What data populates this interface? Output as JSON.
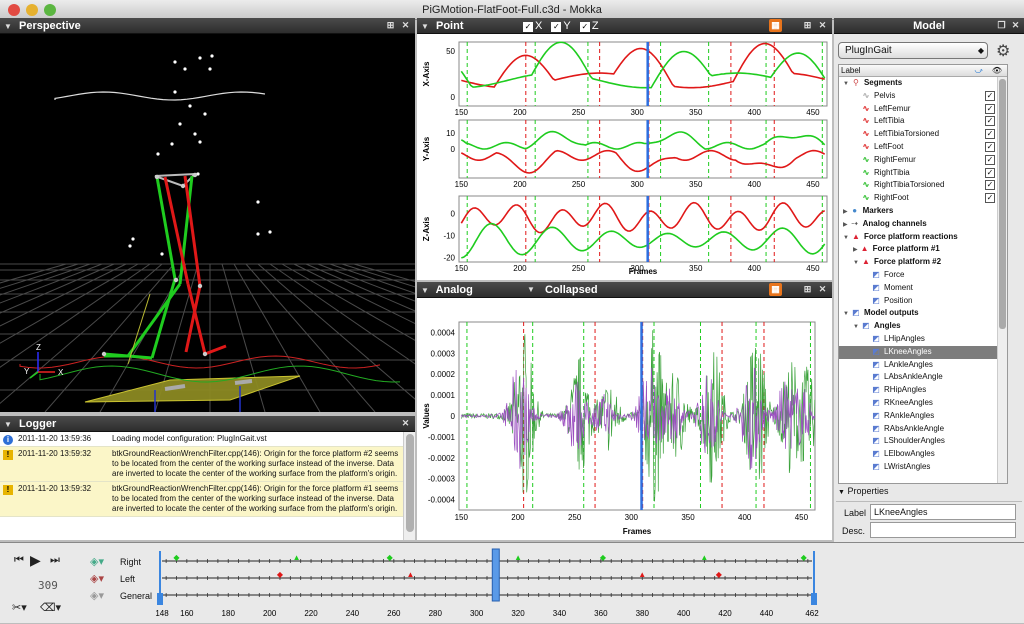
{
  "window": {
    "title": "PiGMotion-FlatFoot-Full.c3d - Mokka"
  },
  "perspective": {
    "title": "Perspective",
    "axes": {
      "x": "X",
      "y": "Y",
      "z": "Z"
    }
  },
  "point": {
    "title": "Point",
    "checks": [
      {
        "label": "X",
        "checked": true
      },
      {
        "label": "Y",
        "checked": true
      },
      {
        "label": "Z",
        "checked": true
      }
    ],
    "xlabel": "Frames",
    "xticks": [
      "150",
      "200",
      "250",
      "300",
      "350",
      "400",
      "450"
    ],
    "plots": [
      {
        "ylabel": "X-Axis",
        "yticks": [
          "50",
          "0"
        ]
      },
      {
        "ylabel": "Y-Axis",
        "yticks": [
          "10",
          "0"
        ]
      },
      {
        "ylabel": "Z-Axis",
        "yticks": [
          "0",
          "-10",
          "-20"
        ]
      }
    ]
  },
  "analog": {
    "title": "Analog",
    "mode": "Collapsed",
    "ylabel": "Values",
    "xlabel": "Frames",
    "yticks": [
      "0.0004",
      "0.0003",
      "0.0002",
      "0.0001",
      "0",
      "-0.0001",
      "-0.0002",
      "-0.0003",
      "-0.0004"
    ],
    "xticks": [
      "150",
      "200",
      "250",
      "300",
      "350",
      "400",
      "450"
    ]
  },
  "logger": {
    "title": "Logger",
    "entries": [
      {
        "level": "info",
        "time": "2011-11-20 13:59:36",
        "text": "Loading model configuration: PlugInGait.vst"
      },
      {
        "level": "warn",
        "time": "2011-11-20 13:59:32",
        "text": "btkGroundReactionWrenchFilter.cpp(146): Origin for the force platform #2 seems to be located from the center of the working surface instead of the inverse. Data are inverted to locate the center of the working surface from the platform's origin."
      },
      {
        "level": "warn",
        "time": "2011-11-20 13:59:32",
        "text": "btkGroundReactionWrenchFilter.cpp(146): Origin for the force platform #1 seems to be located from the center of the working surface instead of the inverse. Data are inverted to locate the center of the working surface from the platform's origin."
      }
    ]
  },
  "model": {
    "title": "Model",
    "selector": "PlugInGait",
    "column": "Label",
    "tree": [
      {
        "label": "Segments",
        "level": 0,
        "bold": true,
        "icon": "segments-icon"
      },
      {
        "label": "Pelvis",
        "level": 1,
        "check": true,
        "color": "#aaaaaa"
      },
      {
        "label": "LeftFemur",
        "level": 1,
        "check": true,
        "color": "#dd2020"
      },
      {
        "label": "LeftTibia",
        "level": 1,
        "check": true,
        "color": "#dd2020"
      },
      {
        "label": "LeftTibiaTorsioned",
        "level": 1,
        "check": true,
        "color": "#dd2020"
      },
      {
        "label": "LeftFoot",
        "level": 1,
        "check": true,
        "color": "#dd2020"
      },
      {
        "label": "RightFemur",
        "level": 1,
        "check": true,
        "color": "#22bb22"
      },
      {
        "label": "RightTibia",
        "level": 1,
        "check": true,
        "color": "#22bb22"
      },
      {
        "label": "RightTibiaTorsioned",
        "level": 1,
        "check": true,
        "color": "#22bb22"
      },
      {
        "label": "RightFoot",
        "level": 1,
        "check": true,
        "color": "#22bb22"
      },
      {
        "label": "Markers",
        "level": 0,
        "bold": true,
        "icon": "markers-icon"
      },
      {
        "label": "Analog channels",
        "level": 0,
        "bold": true,
        "icon": "analog-icon"
      },
      {
        "label": "Force platform reactions",
        "level": 0,
        "bold": true,
        "icon": "force-icon"
      },
      {
        "label": "Force platform #1",
        "level": 1,
        "bold": true,
        "icon": "force-icon"
      },
      {
        "label": "Force platform #2",
        "level": 1,
        "bold": true,
        "icon": "force-icon"
      },
      {
        "label": "Force",
        "level": 2,
        "icon": "graph-icon"
      },
      {
        "label": "Moment",
        "level": 2,
        "icon": "graph-icon"
      },
      {
        "label": "Position",
        "level": 2,
        "icon": "graph-icon"
      },
      {
        "label": "Model outputs",
        "level": 0,
        "bold": true,
        "icon": "graph-icon"
      },
      {
        "label": "Angles",
        "level": 1,
        "bold": true,
        "icon": "graph-icon"
      },
      {
        "label": "LHipAngles",
        "level": 2,
        "icon": "graph-icon"
      },
      {
        "label": "LKneeAngles",
        "level": 2,
        "icon": "graph-icon",
        "selected": true
      },
      {
        "label": "LAnkleAngles",
        "level": 2,
        "icon": "graph-icon"
      },
      {
        "label": "LAbsAnkleAngle",
        "level": 2,
        "icon": "graph-icon"
      },
      {
        "label": "RHipAngles",
        "level": 2,
        "icon": "graph-icon"
      },
      {
        "label": "RKneeAngles",
        "level": 2,
        "icon": "graph-icon"
      },
      {
        "label": "RAnkleAngles",
        "level": 2,
        "icon": "graph-icon"
      },
      {
        "label": "RAbsAnkleAngle",
        "level": 2,
        "icon": "graph-icon"
      },
      {
        "label": "LShoulderAngles",
        "level": 2,
        "icon": "graph-icon"
      },
      {
        "label": "LElbowAngles",
        "level": 2,
        "icon": "graph-icon"
      },
      {
        "label": "LWristAngles",
        "level": 2,
        "icon": "graph-icon"
      }
    ],
    "properties": {
      "title": "Properties",
      "label_caption": "Label",
      "label_value": "LKneeAngles",
      "desc_caption": "Desc.",
      "desc_value": ""
    }
  },
  "timeline": {
    "current_frame": "309",
    "tracks": [
      "Right",
      "Left",
      "General"
    ],
    "ticks": [
      "148",
      "160",
      "180",
      "200",
      "220",
      "240",
      "260",
      "280",
      "300",
      "320",
      "340",
      "360",
      "380",
      "400",
      "420",
      "440",
      "462"
    ]
  },
  "colors": {
    "red": "#e01818",
    "green": "#1fcc1f",
    "purple": "#9b4fc0",
    "blue": "#2e6fe0",
    "panel": "#383838"
  }
}
